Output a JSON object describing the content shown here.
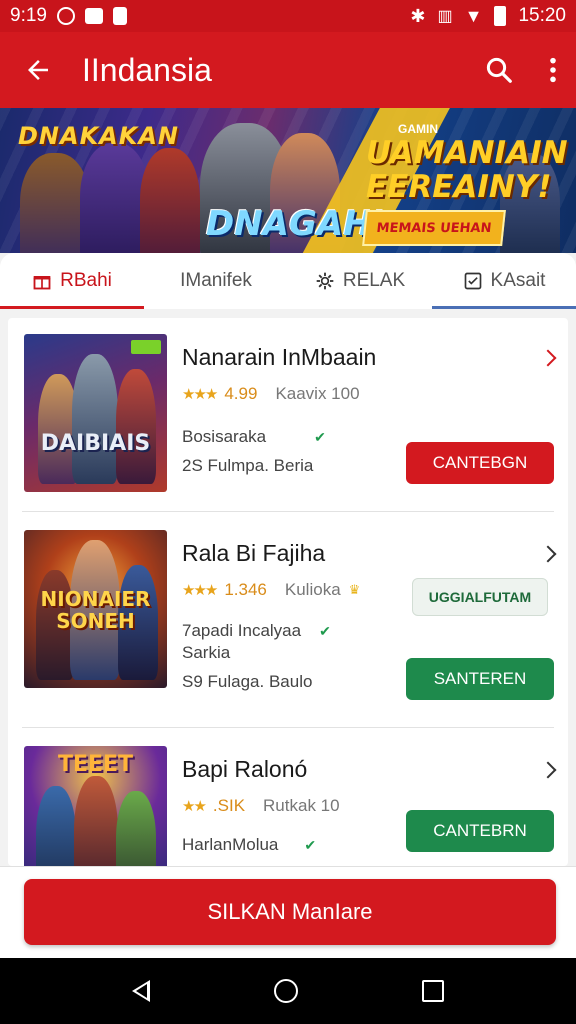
{
  "status_bar": {
    "time": "9:19",
    "clock": "15:20"
  },
  "app_bar": {
    "title": "IIndansia"
  },
  "banner": {
    "badge_left": "DNAKAKAN",
    "logo": "DNAGAHI",
    "mini_tag": "GAMIN",
    "headline": "UAMANIAIN EEREAINY!",
    "cta": "MEMAIS UEHAN"
  },
  "tabs": [
    {
      "label": "RBahi",
      "icon": "gift-icon"
    },
    {
      "label": "IManifek",
      "icon": ""
    },
    {
      "label": "RELAK",
      "icon": "gear-icon"
    },
    {
      "label": "KAsait",
      "icon": "checkbox-icon"
    }
  ],
  "games": [
    {
      "name": "Nanarain InMbaain",
      "rating": "4.99",
      "reviews": "Kaavix 100",
      "line1": "Bosisaraka",
      "line2": "2S Fulmpa. Beria",
      "button": "CANTEBGN",
      "thumb_title": "DAIBIAIS"
    },
    {
      "name": "Rala Bi Fajiha",
      "rating": "1.346",
      "reviews": "Kulioka",
      "secondary_button": "UGGIALFUTAM",
      "line1": "7apadi Incalyaa",
      "line1b": "Sarkia",
      "line2": "S9 Fulaga. Baulo",
      "button": "SANTEREN",
      "thumb_title": "NIONAIER SONEH"
    },
    {
      "name": "Bapi Ralonó",
      "rating": ".SIK",
      "reviews": "Rutkak 10",
      "line1": "HarlanMolua",
      "button": "CANTEBRN",
      "thumb_title": "TEEET"
    }
  ],
  "bottom_button": "SILKAN ManIare",
  "colors": {
    "primary_red": "#d3191f",
    "green": "#1e8a4c"
  }
}
